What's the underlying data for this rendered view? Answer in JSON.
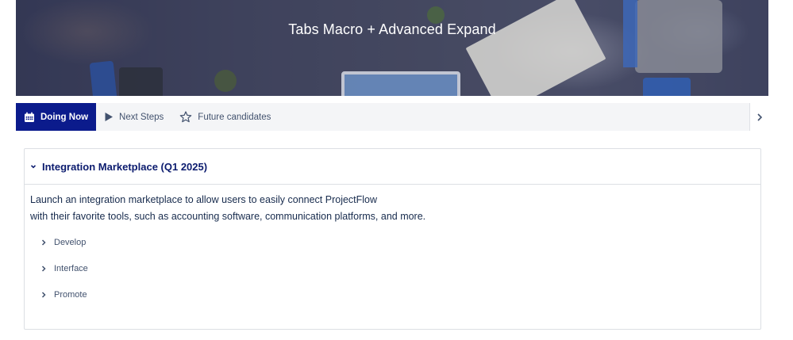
{
  "banner": {
    "title": "Tabs Macro + Advanced Expand"
  },
  "tabs": [
    {
      "label": "Doing Now",
      "icon": "calendar-icon",
      "active": true
    },
    {
      "label": "Next Steps",
      "icon": "play-icon",
      "active": false
    },
    {
      "label": "Future candidates",
      "icon": "star-icon",
      "active": false
    }
  ],
  "expand": {
    "title": "Integration Marketplace (Q1 2025)",
    "description_line1": "Launch an integration marketplace to allow users to easily connect ProjectFlow",
    "description_line2": "with their favorite tools, such as accounting software, communication platforms, and more.",
    "items": [
      {
        "label": "Develop"
      },
      {
        "label": "Interface"
      },
      {
        "label": "Promote"
      }
    ]
  },
  "colors": {
    "active_tab_bg": "#0b1b8c",
    "tabbar_bg": "#f4f5f7",
    "title_color": "#0b1b6e",
    "text": "#172b4d"
  }
}
